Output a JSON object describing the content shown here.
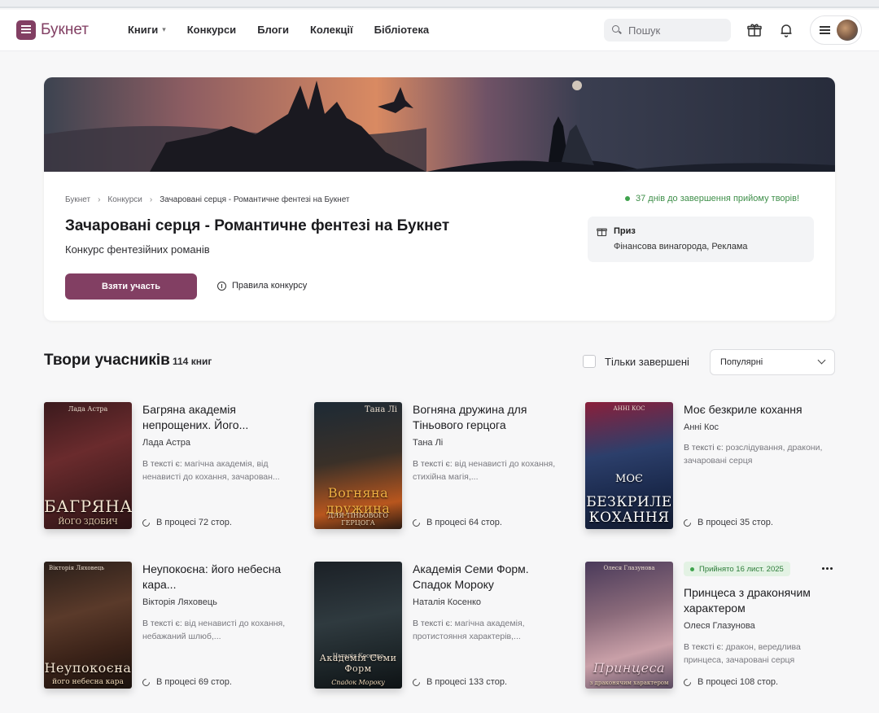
{
  "header": {
    "logo_text": "Букнет",
    "nav": [
      {
        "label": "Книги",
        "has_dropdown": true
      },
      {
        "label": "Конкурси"
      },
      {
        "label": "Блоги"
      },
      {
        "label": "Колекції"
      },
      {
        "label": "Бібліотека"
      }
    ],
    "search_placeholder": "Пошук",
    "icons": [
      "gift-icon",
      "bell-icon",
      "menu-icon"
    ]
  },
  "hero": {
    "breadcrumb": [
      "Букнет",
      "Конкурси",
      "Зачаровані серця - Романтичне фентезі на Букнет"
    ],
    "deadline": "37 днів до завершення прийому творів!",
    "title": "Зачаровані серця - Романтичне фентезі на Букнет",
    "subtitle": "Конкурс фентезійних романів",
    "join_label": "Взяти участь",
    "rules_label": "Правила конкурсу",
    "prize_label": "Приз",
    "prize_value": "Фінансова винагорода, Реклама"
  },
  "section": {
    "title": "Твори учасників",
    "count": "114 книг",
    "completed_filter": "Тільки завершені",
    "sort_value": "Популярні"
  },
  "books": [
    {
      "title": "Багряна академія непрощених. Його...",
      "author": "Лада Астра",
      "tags_label": "В тексті є:",
      "tags": "магічна академія, від ненависті до кохання, зачарован...",
      "status": "В процесі 72 стор.",
      "cover_title": "БАГРЯНА",
      "cover_sub": "ЙОГО ЗДОБИЧ",
      "cover_author": "Лада Астра"
    },
    {
      "title": "Вогняна дружина для Тіньового герцога",
      "author": "Тана Лі",
      "tags_label": "В тексті є:",
      "tags": "від ненависті до кохання, стихійна магія,...",
      "status": "В процесі 64 стор.",
      "cover_title": "Вогняна дружина",
      "cover_sub": "ДЛЯ ТІНЬОВОГО ГЕРЦОГА",
      "cover_author": "Тана Лі"
    },
    {
      "title": "Моє безкриле кохання",
      "author": "Анні Кос",
      "tags_label": "В тексті є:",
      "tags": "розслідування, дракони, зачаровані серця",
      "status": "В процесі 35 стор.",
      "cover_title": "БЕЗКРИЛЕ КОХАННЯ",
      "cover_sub": "МОЄ",
      "cover_author": "АННІ КОС"
    },
    {
      "title": "Неупокоєна: його небесна кара...",
      "author": "Вікторія Ляховець",
      "tags_label": "В тексті є:",
      "tags": "від ненависті до кохання, небажаний шлюб,...",
      "status": "В процесі 69 стор.",
      "cover_title": "Неупокоєна",
      "cover_sub": "його небесна кара",
      "cover_author": "Вікторія Ляховець"
    },
    {
      "title": "Академія Семи Форм. Спадок Мороку",
      "author": "Наталія Косенко",
      "tags_label": "В тексті є:",
      "tags": "магічна академія, протистояння характерів,...",
      "status": "В процесі 133 стор.",
      "cover_title": "Академія Семи Форм",
      "cover_sub": "Спадок Мороку",
      "cover_author": "Наталія Косенко"
    },
    {
      "badge": "Прийнято 16 лист. 2025",
      "title": "Принцеса з драконячим характером",
      "author": "Олеся Глазунова",
      "tags_label": "В тексті є:",
      "tags": "дракон, вередлива принцеса, зачаровані серця",
      "status": "В процесі 108 стор.",
      "cover_title": "Принцеса",
      "cover_sub": "з драконячим характером",
      "cover_author": "Олеся Глазунова"
    }
  ],
  "colors": {
    "brand": "#823f63",
    "success": "#3fa34d"
  }
}
